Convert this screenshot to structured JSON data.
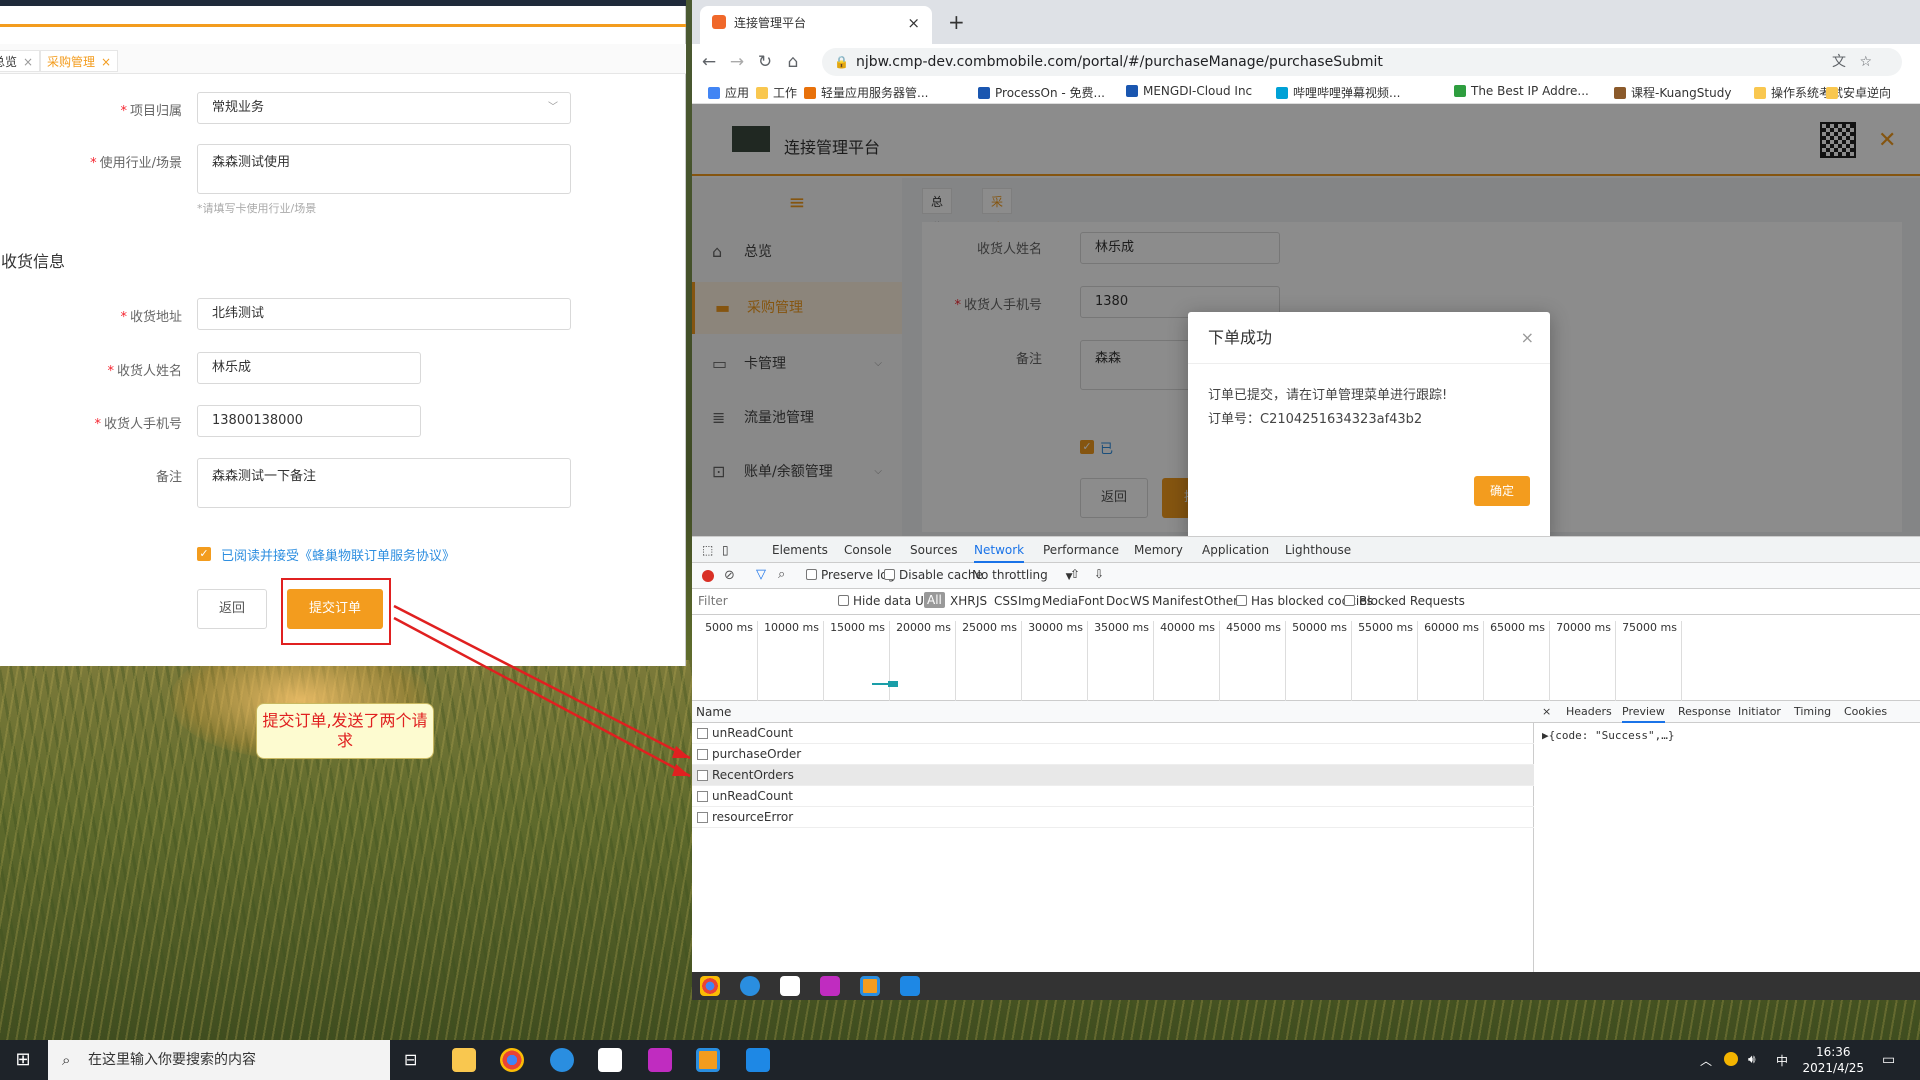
{
  "left_form": {
    "tabs": [
      {
        "label": "总览",
        "close": "×"
      },
      {
        "label": "采购管理",
        "close": "×"
      }
    ],
    "fields": {
      "project_label": "项目归属",
      "project_value": "常规业务",
      "usage_label": "使用行业/场景",
      "usage_value": "森森测试使用",
      "usage_hint": "*请填写卡使用行业/场景",
      "section_title": "收货信息",
      "address_label": "收货地址",
      "address_value": "北纬测试",
      "name_label": "收货人姓名",
      "name_value": "林乐成",
      "phone_label": "收货人手机号",
      "phone_value": "13800138000",
      "remark_label": "备注",
      "remark_value": "森森测试一下备注"
    },
    "agreement": "已阅读并接受《蜂巢物联订单服务协议》",
    "back_button": "返回",
    "submit_button": "提交订单",
    "annotation": "提交订单,发送了两个请求"
  },
  "browser": {
    "tab_title": "连接管理平台",
    "tab_close": "×",
    "new_tab": "+",
    "url": "njbw.cmp-dev.combmobile.com/portal/#/purchaseManage/purchaseSubmit",
    "bookmarks": [
      "应用",
      "工作",
      "轻量应用服务器管...",
      "ProcessOn - 免费...",
      "MENGDI-Cloud Inc",
      "哔哩哔哩弹幕视频...",
      "The Best IP Addre...",
      "课程-KuangStudy",
      "操作系统考试",
      "安卓逆向"
    ],
    "bookmark_colors": [
      "#4285f4",
      "#f9c74f",
      "#e8710a",
      "#1a56b0",
      "#1a56b0",
      "#00a1d6",
      "#2e9e3f",
      "#8b5a2b",
      "#f9c74f",
      "#f9c74f"
    ]
  },
  "page": {
    "title": "连接管理平台",
    "sidebar": [
      {
        "label": "总览",
        "icon": "home-icon",
        "chevron": ""
      },
      {
        "label": "采购管理",
        "icon": "cart-icon",
        "chevron": ""
      },
      {
        "label": "卡管理",
        "icon": "card-icon",
        "chevron": "⌵"
      },
      {
        "label": "流量池管理",
        "icon": "database-icon",
        "chevron": ""
      },
      {
        "label": "账单/余额管理",
        "icon": "lock-icon",
        "chevron": "⌵"
      }
    ],
    "tabs": [
      {
        "label": "总览",
        "close": "×"
      },
      {
        "label": "采购管理",
        "close": "×"
      }
    ],
    "bg_labels": {
      "receiver": "收货人姓名",
      "receiver_value": "林乐成",
      "phone": "收货人手机号",
      "phone_value": "1380",
      "remark": "备注",
      "remark_value": "森森",
      "agree_partial": "已",
      "back": "返回",
      "submit": "提交订单"
    },
    "modal": {
      "title": "下单成功",
      "close": "×",
      "line1": "订单已提交，请在订单管理菜单进行跟踪!",
      "line2": "订单号：C2104251634323af43b2",
      "ok": "确定"
    }
  },
  "devtools": {
    "tabs": [
      "Elements",
      "Console",
      "Sources",
      "Network",
      "Performance",
      "Memory",
      "Application",
      "Lighthouse"
    ],
    "active_tab": "Network",
    "toolbar": {
      "preserve_log": "Preserve log",
      "disable_cache": "Disable cache",
      "throttling": "No throttling"
    },
    "filter_placeholder": "Filter",
    "filter_types": [
      "Hide data URLs",
      "All",
      "XHR",
      "JS",
      "CSS",
      "Img",
      "Media",
      "Font",
      "Doc",
      "WS",
      "Manifest",
      "Other",
      "Has blocked cookies",
      "Blocked Requests"
    ],
    "timeline_ticks": [
      "5000 ms",
      "10000 ms",
      "15000 ms",
      "20000 ms",
      "25000 ms",
      "30000 ms",
      "35000 ms",
      "40000 ms",
      "45000 ms",
      "50000 ms",
      "55000 ms",
      "60000 ms",
      "65000 ms",
      "70000 ms",
      "75000 ms"
    ],
    "name_header": "Name",
    "requests": [
      "unReadCount",
      "purchaseOrder",
      "RecentOrders",
      "unReadCount",
      "resourceError"
    ],
    "detail_tabs": [
      "×",
      "Headers",
      "Preview",
      "Response",
      "Initiator",
      "Timing",
      "Cookies"
    ],
    "preview_text": "▶{code: \"Success\",…}"
  },
  "taskbar": {
    "search_placeholder": "在这里输入你要搜索的内容",
    "time": "16:36",
    "date": "2021/4/25",
    "ime": "中"
  }
}
